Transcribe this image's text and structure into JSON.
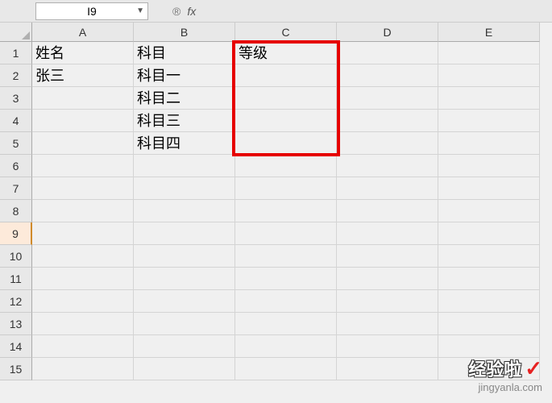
{
  "formula_bar": {
    "name_box": "I9",
    "fx_label": "fx"
  },
  "columns": [
    "A",
    "B",
    "C",
    "D",
    "E"
  ],
  "rows": [
    "1",
    "2",
    "3",
    "4",
    "5",
    "6",
    "7",
    "8",
    "9",
    "10",
    "11",
    "12",
    "13",
    "14",
    "15"
  ],
  "selected_row_index": 8,
  "cells": {
    "A1": "姓名",
    "B1": "科目",
    "C1": "等级",
    "A2": "张三",
    "B2": "科目一",
    "B3": "科目二",
    "B4": "科目三",
    "B5": "科目四"
  },
  "highlight": {
    "col_start": 2,
    "row_start": 0,
    "row_end": 5
  },
  "watermark": {
    "text": "经验啦",
    "url": "jingyanla.com"
  }
}
